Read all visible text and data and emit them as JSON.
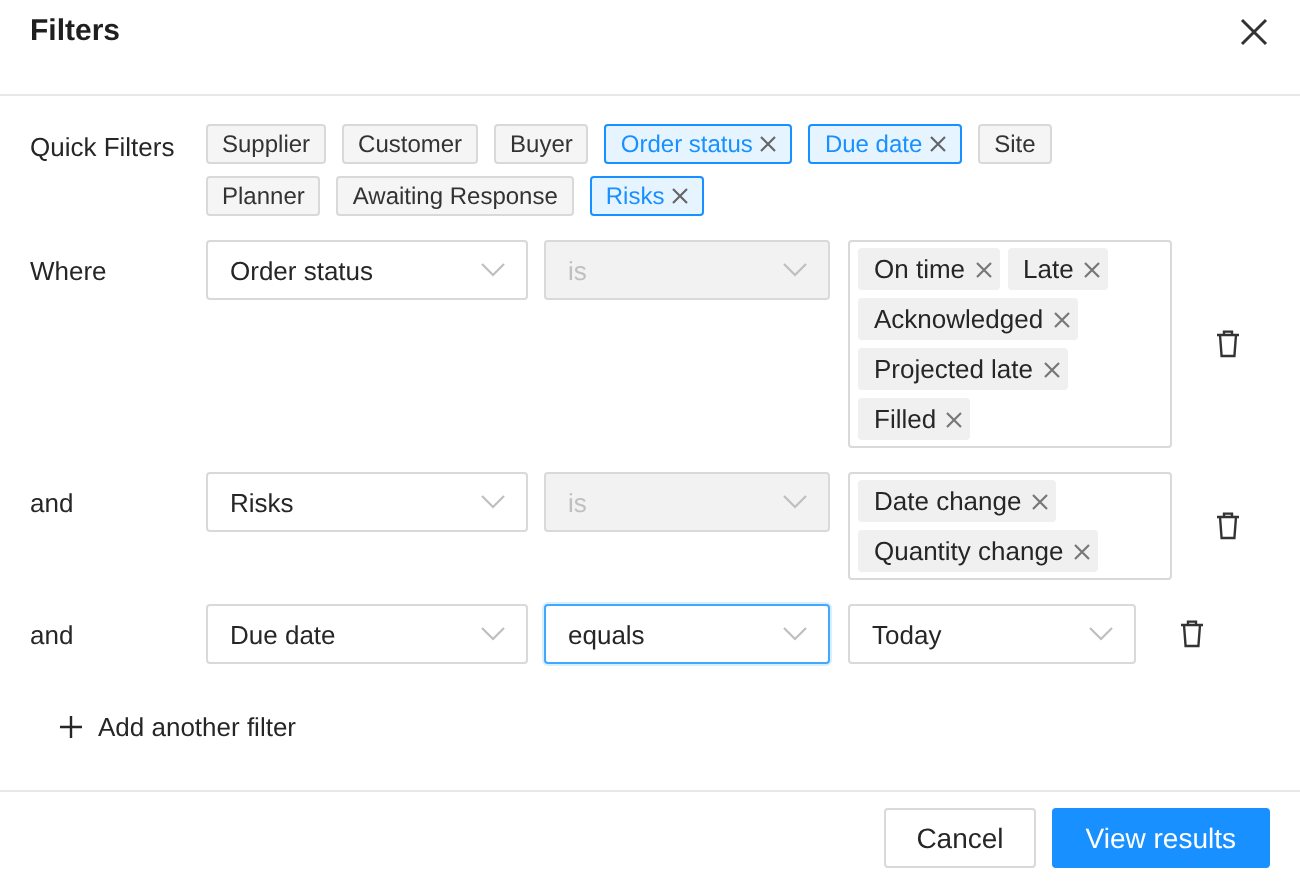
{
  "window": {
    "title": "Filters"
  },
  "quick_filters": {
    "label": "Quick Filters",
    "chips": [
      {
        "label": "Supplier",
        "selected": false
      },
      {
        "label": "Customer",
        "selected": false
      },
      {
        "label": "Buyer",
        "selected": false
      },
      {
        "label": "Order status",
        "selected": true
      },
      {
        "label": "Due date",
        "selected": true
      },
      {
        "label": "Site",
        "selected": false
      },
      {
        "label": "Planner",
        "selected": false
      },
      {
        "label": "Awaiting Response",
        "selected": false
      },
      {
        "label": "Risks",
        "selected": true
      }
    ]
  },
  "conditions": [
    {
      "connector": "Where",
      "field": "Order status",
      "operator": {
        "value": "is",
        "disabled": true,
        "focused": false
      },
      "value": {
        "kind": "tags",
        "tags": [
          "On time",
          "Late",
          "Acknowledged",
          "Projected late",
          "Filled"
        ]
      }
    },
    {
      "connector": "and",
      "field": "Risks",
      "operator": {
        "value": "is",
        "disabled": true,
        "focused": false
      },
      "value": {
        "kind": "tags",
        "tags": [
          "Date change",
          "Quantity change"
        ]
      }
    },
    {
      "connector": "and",
      "field": "Due date",
      "operator": {
        "value": "equals",
        "disabled": false,
        "focused": true
      },
      "value": {
        "kind": "select",
        "text": "Today"
      }
    }
  ],
  "add_filter": "Add another filter",
  "buttons": [
    {
      "label": "Cancel",
      "kind": "secondary"
    },
    {
      "label": "View results",
      "kind": "primary"
    }
  ]
}
